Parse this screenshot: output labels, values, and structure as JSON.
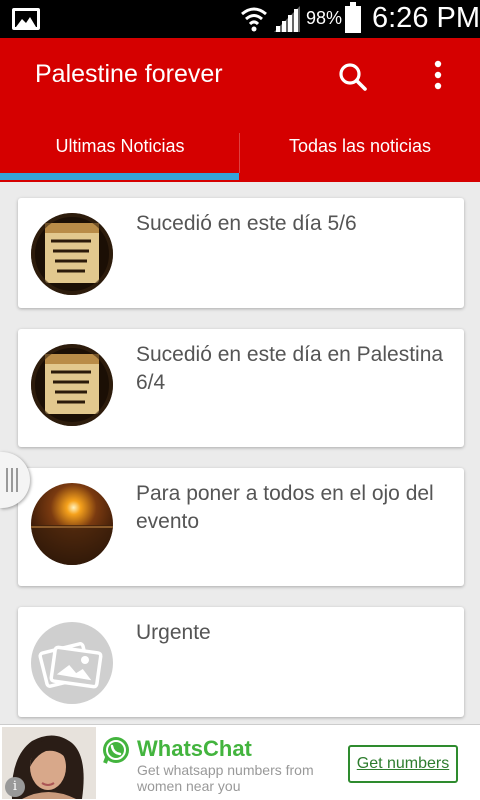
{
  "status_bar": {
    "battery": "98%",
    "time": "6:26 PM",
    "icons": [
      "gallery-icon",
      "wifi-icon",
      "signal-icon",
      "battery-icon"
    ]
  },
  "app_bar": {
    "title": "Palestine forever",
    "icons": [
      "search-icon",
      "more-vert-icon"
    ],
    "color": "#d50000"
  },
  "tabs": [
    {
      "label": "Ultimas Noticias",
      "selected": true
    },
    {
      "label": "Todas las noticias",
      "selected": false
    }
  ],
  "tab_indicator_color": "#36a3d9",
  "news": [
    {
      "title": "Sucedió en este día 5/6",
      "thumb": "calendar-arabic-thumb"
    },
    {
      "title": "Sucedió en este día en Palestina 6/4",
      "thumb": "calendar-arabic-thumb"
    },
    {
      "title": "Para poner a todos en el ojo del evento",
      "thumb": "sunset-thumb"
    },
    {
      "title": "Urgente",
      "thumb": "image-placeholder-icon"
    }
  ],
  "ad": {
    "brand": "WhatsChat",
    "text": "Get whatsapp numbers from women near you",
    "cta": "Get numbers",
    "info": "i",
    "brand_color": "#43b43e"
  }
}
